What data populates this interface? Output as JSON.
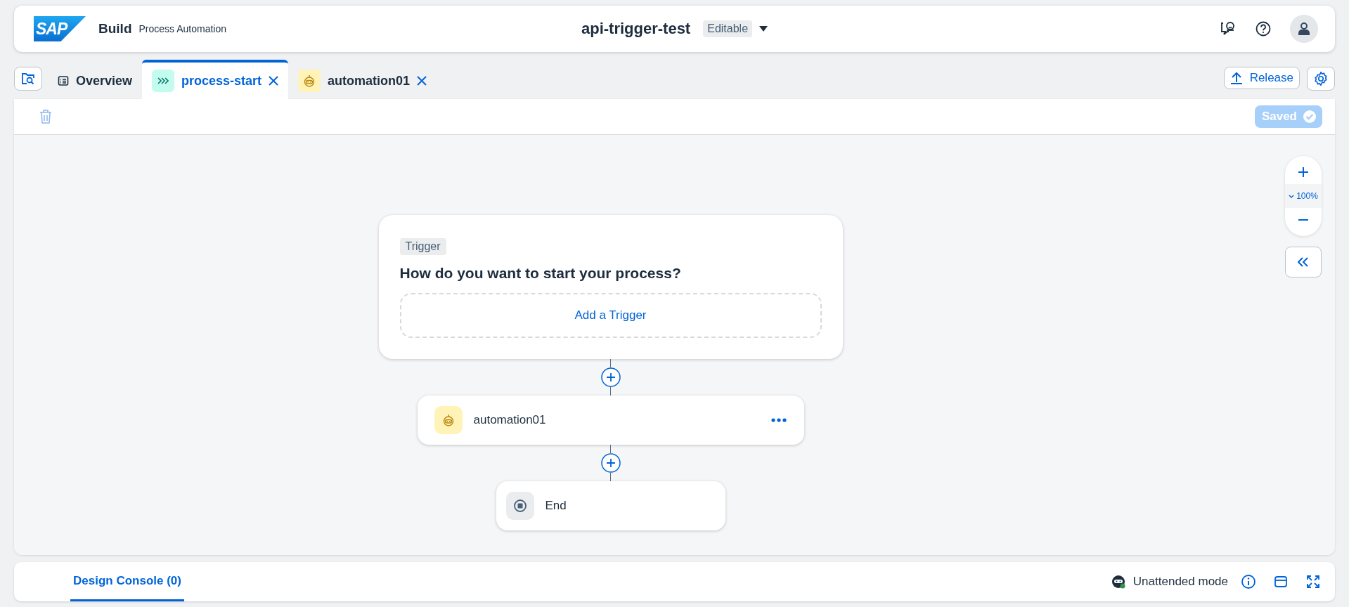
{
  "header": {
    "logo": "SAP",
    "product": "Build",
    "subtitle": "Process Automation",
    "project": "api-trigger-test",
    "status": "Editable"
  },
  "tabs": [
    {
      "label": "Overview",
      "kind": "overview",
      "selected": false,
      "closable": false
    },
    {
      "label": "process-start",
      "kind": "process",
      "selected": true,
      "closable": true
    },
    {
      "label": "automation01",
      "kind": "automation",
      "selected": false,
      "closable": true
    }
  ],
  "actions": {
    "release": "Release"
  },
  "toolbar": {
    "saved": "Saved"
  },
  "canvas": {
    "zoom": "100%",
    "trigger": {
      "tag": "Trigger",
      "question": "How do you want to start your process?",
      "add": "Add a Trigger"
    },
    "steps": [
      {
        "kind": "automation",
        "label": "automation01"
      },
      {
        "kind": "end",
        "label": "End"
      }
    ]
  },
  "console": {
    "tabs": [
      {
        "label": "Design Console (0)",
        "selected": true
      }
    ],
    "mode": "Unattended mode"
  }
}
